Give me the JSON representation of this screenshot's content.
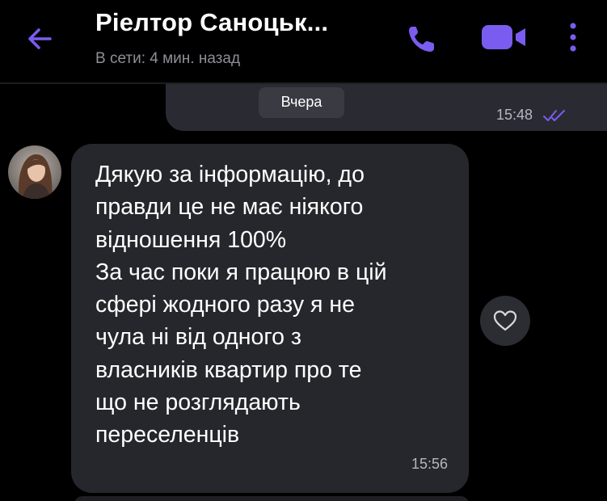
{
  "header": {
    "title": "Ріелтор Саноцьк...",
    "status": "В сети: 4 мин. назад",
    "icons": {
      "back": "arrow-left-icon",
      "call": "phone-icon",
      "video": "video-camera-icon",
      "more": "more-vertical-icon"
    }
  },
  "chat": {
    "previous_message": {
      "date_label": "Вчера",
      "time": "15:48",
      "status_icon": "read-double-check-icon"
    },
    "incoming_message": {
      "text": "Дякую за інформацію, до\nправди це не має ніякого\nвідношення 100%\nЗа час поки я працюю в цій\nсфері жодного разу я не\nчула ні від одного з\nвласників квартир про те\nщо не розглядають\nпереселенців",
      "time": "15:56",
      "reaction_icon": "heart-outline-icon"
    }
  },
  "colors": {
    "accent": "#7b5cf0",
    "background": "#000000",
    "incoming_bubble": "#26262d",
    "outgoing_bubble": "#2a2a33"
  }
}
